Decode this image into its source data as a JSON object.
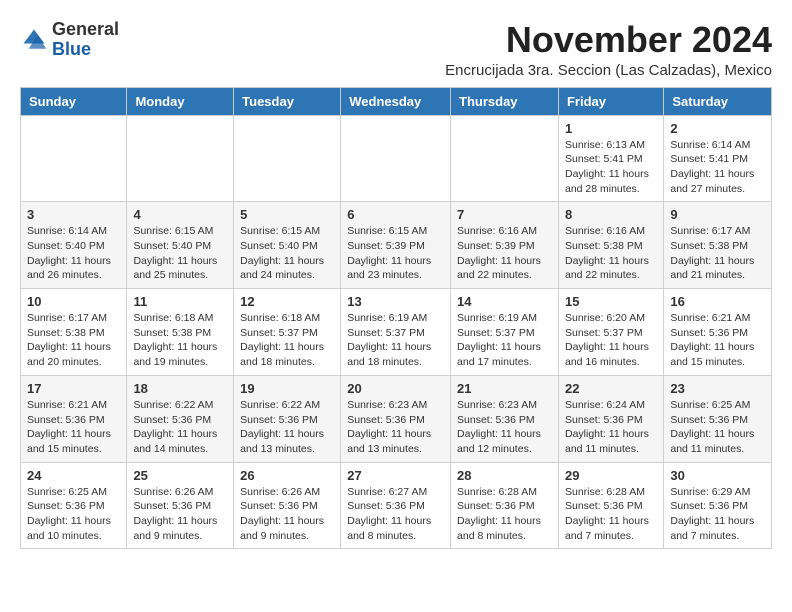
{
  "logo": {
    "general": "General",
    "blue": "Blue"
  },
  "header": {
    "title": "November 2024",
    "location": "Encrucijada 3ra. Seccion (Las Calzadas), Mexico"
  },
  "weekdays": [
    "Sunday",
    "Monday",
    "Tuesday",
    "Wednesday",
    "Thursday",
    "Friday",
    "Saturday"
  ],
  "weeks": [
    [
      {
        "day": "",
        "info": ""
      },
      {
        "day": "",
        "info": ""
      },
      {
        "day": "",
        "info": ""
      },
      {
        "day": "",
        "info": ""
      },
      {
        "day": "",
        "info": ""
      },
      {
        "day": "1",
        "info": "Sunrise: 6:13 AM\nSunset: 5:41 PM\nDaylight: 11 hours and 28 minutes."
      },
      {
        "day": "2",
        "info": "Sunrise: 6:14 AM\nSunset: 5:41 PM\nDaylight: 11 hours and 27 minutes."
      }
    ],
    [
      {
        "day": "3",
        "info": "Sunrise: 6:14 AM\nSunset: 5:40 PM\nDaylight: 11 hours and 26 minutes."
      },
      {
        "day": "4",
        "info": "Sunrise: 6:15 AM\nSunset: 5:40 PM\nDaylight: 11 hours and 25 minutes."
      },
      {
        "day": "5",
        "info": "Sunrise: 6:15 AM\nSunset: 5:40 PM\nDaylight: 11 hours and 24 minutes."
      },
      {
        "day": "6",
        "info": "Sunrise: 6:15 AM\nSunset: 5:39 PM\nDaylight: 11 hours and 23 minutes."
      },
      {
        "day": "7",
        "info": "Sunrise: 6:16 AM\nSunset: 5:39 PM\nDaylight: 11 hours and 22 minutes."
      },
      {
        "day": "8",
        "info": "Sunrise: 6:16 AM\nSunset: 5:38 PM\nDaylight: 11 hours and 22 minutes."
      },
      {
        "day": "9",
        "info": "Sunrise: 6:17 AM\nSunset: 5:38 PM\nDaylight: 11 hours and 21 minutes."
      }
    ],
    [
      {
        "day": "10",
        "info": "Sunrise: 6:17 AM\nSunset: 5:38 PM\nDaylight: 11 hours and 20 minutes."
      },
      {
        "day": "11",
        "info": "Sunrise: 6:18 AM\nSunset: 5:38 PM\nDaylight: 11 hours and 19 minutes."
      },
      {
        "day": "12",
        "info": "Sunrise: 6:18 AM\nSunset: 5:37 PM\nDaylight: 11 hours and 18 minutes."
      },
      {
        "day": "13",
        "info": "Sunrise: 6:19 AM\nSunset: 5:37 PM\nDaylight: 11 hours and 18 minutes."
      },
      {
        "day": "14",
        "info": "Sunrise: 6:19 AM\nSunset: 5:37 PM\nDaylight: 11 hours and 17 minutes."
      },
      {
        "day": "15",
        "info": "Sunrise: 6:20 AM\nSunset: 5:37 PM\nDaylight: 11 hours and 16 minutes."
      },
      {
        "day": "16",
        "info": "Sunrise: 6:21 AM\nSunset: 5:36 PM\nDaylight: 11 hours and 15 minutes."
      }
    ],
    [
      {
        "day": "17",
        "info": "Sunrise: 6:21 AM\nSunset: 5:36 PM\nDaylight: 11 hours and 15 minutes."
      },
      {
        "day": "18",
        "info": "Sunrise: 6:22 AM\nSunset: 5:36 PM\nDaylight: 11 hours and 14 minutes."
      },
      {
        "day": "19",
        "info": "Sunrise: 6:22 AM\nSunset: 5:36 PM\nDaylight: 11 hours and 13 minutes."
      },
      {
        "day": "20",
        "info": "Sunrise: 6:23 AM\nSunset: 5:36 PM\nDaylight: 11 hours and 13 minutes."
      },
      {
        "day": "21",
        "info": "Sunrise: 6:23 AM\nSunset: 5:36 PM\nDaylight: 11 hours and 12 minutes."
      },
      {
        "day": "22",
        "info": "Sunrise: 6:24 AM\nSunset: 5:36 PM\nDaylight: 11 hours and 11 minutes."
      },
      {
        "day": "23",
        "info": "Sunrise: 6:25 AM\nSunset: 5:36 PM\nDaylight: 11 hours and 11 minutes."
      }
    ],
    [
      {
        "day": "24",
        "info": "Sunrise: 6:25 AM\nSunset: 5:36 PM\nDaylight: 11 hours and 10 minutes."
      },
      {
        "day": "25",
        "info": "Sunrise: 6:26 AM\nSunset: 5:36 PM\nDaylight: 11 hours and 9 minutes."
      },
      {
        "day": "26",
        "info": "Sunrise: 6:26 AM\nSunset: 5:36 PM\nDaylight: 11 hours and 9 minutes."
      },
      {
        "day": "27",
        "info": "Sunrise: 6:27 AM\nSunset: 5:36 PM\nDaylight: 11 hours and 8 minutes."
      },
      {
        "day": "28",
        "info": "Sunrise: 6:28 AM\nSunset: 5:36 PM\nDaylight: 11 hours and 8 minutes."
      },
      {
        "day": "29",
        "info": "Sunrise: 6:28 AM\nSunset: 5:36 PM\nDaylight: 11 hours and 7 minutes."
      },
      {
        "day": "30",
        "info": "Sunrise: 6:29 AM\nSunset: 5:36 PM\nDaylight: 11 hours and 7 minutes."
      }
    ]
  ]
}
